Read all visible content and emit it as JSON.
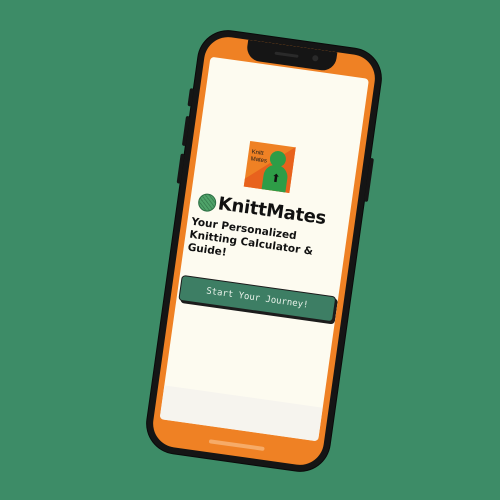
{
  "app": {
    "logo_text_line1": "Knitt",
    "logo_text_line2": "Mates",
    "brand_name": "KnittMates",
    "tagline": "Your Personalized Knitting Calculator & Guide!",
    "cta_label": "Start Your Journey!"
  },
  "colors": {
    "background": "#3d8c67",
    "phone_frame": "#151515",
    "screen_border": "#ef8124",
    "content_bg": "#fdfbf0",
    "button_bg": "#3d7e64",
    "mascot": "#2e9d47"
  },
  "icons": {
    "brand": "yarn-ball-icon",
    "mascot": "mascot-logo-icon"
  }
}
